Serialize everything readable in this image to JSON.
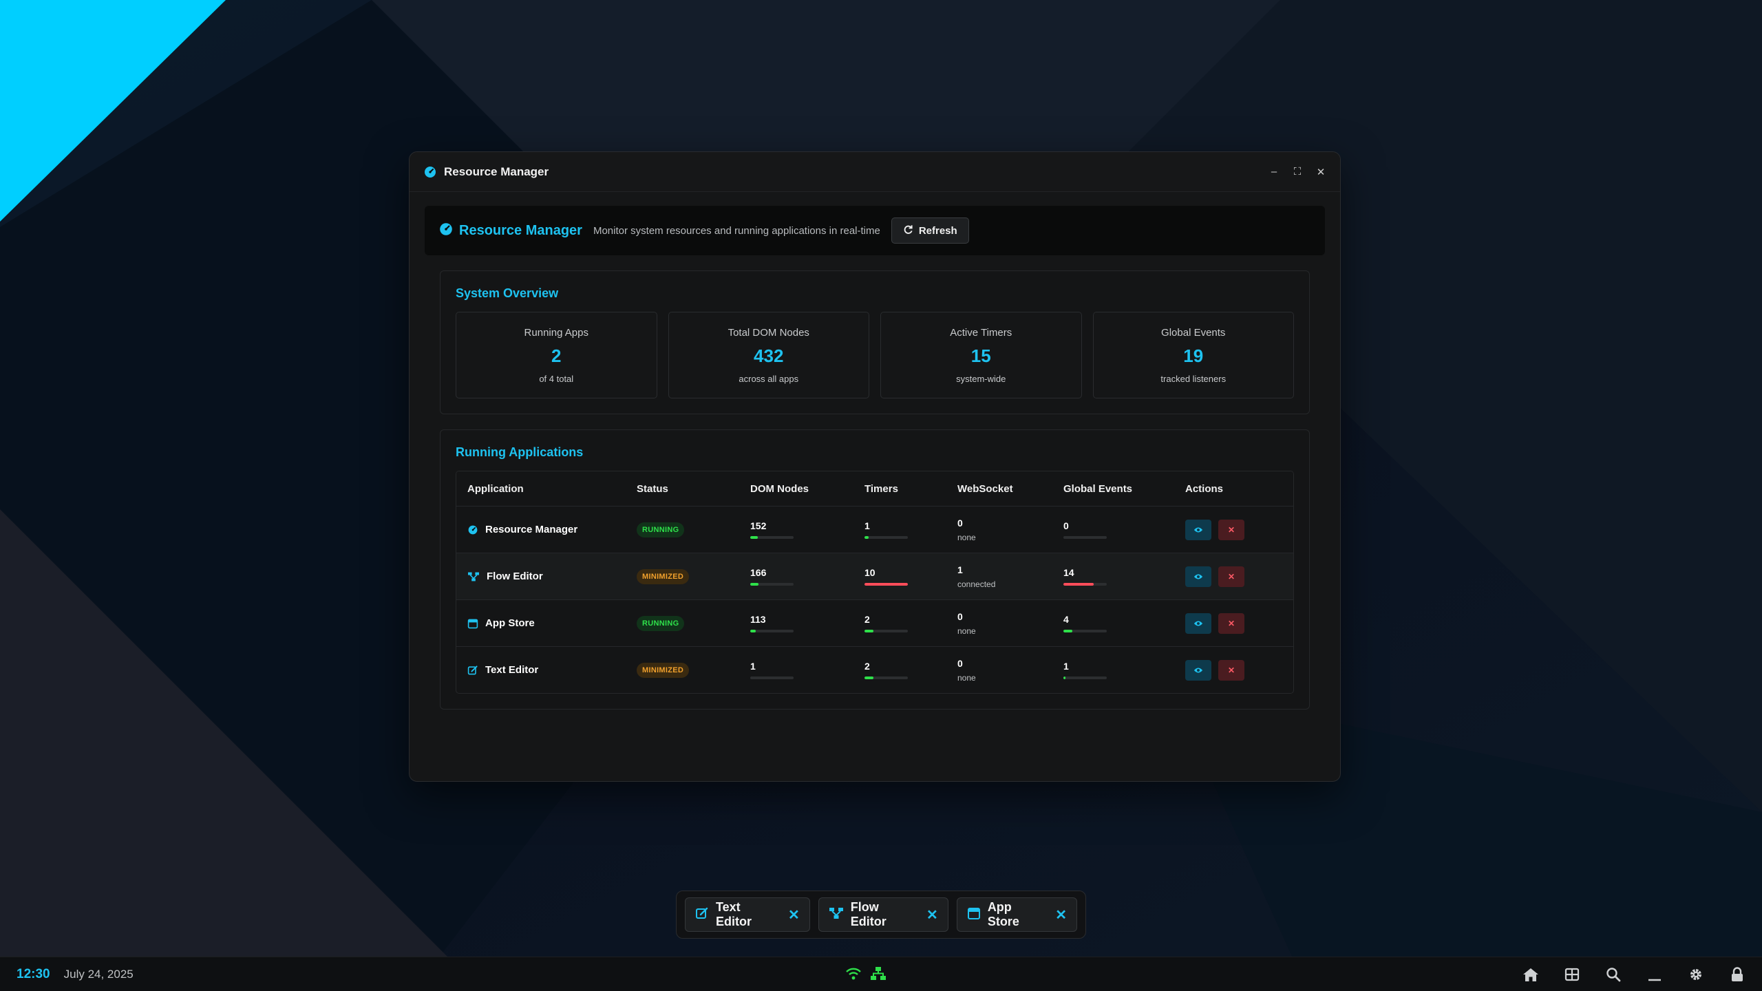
{
  "colors": {
    "accent": "#1ec2f0",
    "running": "#2ee04a",
    "minimized": "#f0a02c",
    "danger": "#ff4d5a",
    "bar_ok": "#2ee04a",
    "bar_high": "#ff4d5a"
  },
  "window": {
    "title": "Resource Manager",
    "icon": "gauge-icon",
    "controls": {
      "minimize": "–",
      "maximize": "⛶",
      "close": "✕"
    }
  },
  "header": {
    "brand": "Resource Manager",
    "subtitle": "Monitor system resources and running applications in real-time",
    "refresh_label": "Refresh"
  },
  "overview": {
    "title": "System Overview",
    "cards": [
      {
        "label": "Running Apps",
        "value": "2",
        "sub": "of 4 total"
      },
      {
        "label": "Total DOM Nodes",
        "value": "432",
        "sub": "across all apps"
      },
      {
        "label": "Active Timers",
        "value": "15",
        "sub": "system-wide"
      },
      {
        "label": "Global Events",
        "value": "19",
        "sub": "tracked listeners"
      }
    ]
  },
  "apps": {
    "title": "Running Applications",
    "columns": [
      "Application",
      "Status",
      "DOM Nodes",
      "Timers",
      "WebSocket",
      "Global Events",
      "Actions"
    ],
    "rows": [
      {
        "name": "Resource Manager",
        "icon": "gauge-icon",
        "status": "RUNNING",
        "status_kind": "running",
        "dom": "152",
        "dom_pct": 0.18,
        "dom_level": "ok",
        "timers": "1",
        "timers_pct": 0.1,
        "timers_level": "ok",
        "ws": "0",
        "ws_sub": "none",
        "ge": "0",
        "ge_pct": 0,
        "ge_level": "ok"
      },
      {
        "name": "Flow Editor",
        "icon": "flow-icon",
        "status": "MINIMIZED",
        "status_kind": "minimized",
        "dom": "166",
        "dom_pct": 0.19,
        "dom_level": "ok",
        "timers": "10",
        "timers_pct": 1.0,
        "timers_level": "high",
        "ws": "1",
        "ws_sub": "connected",
        "ge": "14",
        "ge_pct": 0.7,
        "ge_level": "high"
      },
      {
        "name": "App Store",
        "icon": "store-icon",
        "status": "RUNNING",
        "status_kind": "running",
        "dom": "113",
        "dom_pct": 0.13,
        "dom_level": "ok",
        "timers": "2",
        "timers_pct": 0.2,
        "timers_level": "ok",
        "ws": "0",
        "ws_sub": "none",
        "ge": "4",
        "ge_pct": 0.2,
        "ge_level": "ok"
      },
      {
        "name": "Text Editor",
        "icon": "edit-icon",
        "status": "MINIMIZED",
        "status_kind": "minimized",
        "dom": "1",
        "dom_pct": 0.0,
        "dom_level": "ok",
        "timers": "2",
        "timers_pct": 0.2,
        "timers_level": "ok",
        "ws": "0",
        "ws_sub": "none",
        "ge": "1",
        "ge_pct": 0.05,
        "ge_level": "ok"
      }
    ],
    "action_view": "eye-icon",
    "action_kill": "✕"
  },
  "dock": {
    "items": [
      {
        "label": "Text Editor",
        "icon": "edit-icon",
        "close": "✕"
      },
      {
        "label": "Flow Editor",
        "icon": "flow-icon",
        "close": "✕"
      },
      {
        "label": "App Store",
        "icon": "store-icon",
        "close": "✕"
      }
    ]
  },
  "taskbar": {
    "time": "12:30",
    "date": "July 24, 2025",
    "center_icons": [
      "wifi-icon",
      "network-icon"
    ],
    "right_icons": [
      "home-icon",
      "grid-icon",
      "search-icon",
      "minimize-all-icon",
      "settings-icon",
      "lock-icon"
    ]
  }
}
